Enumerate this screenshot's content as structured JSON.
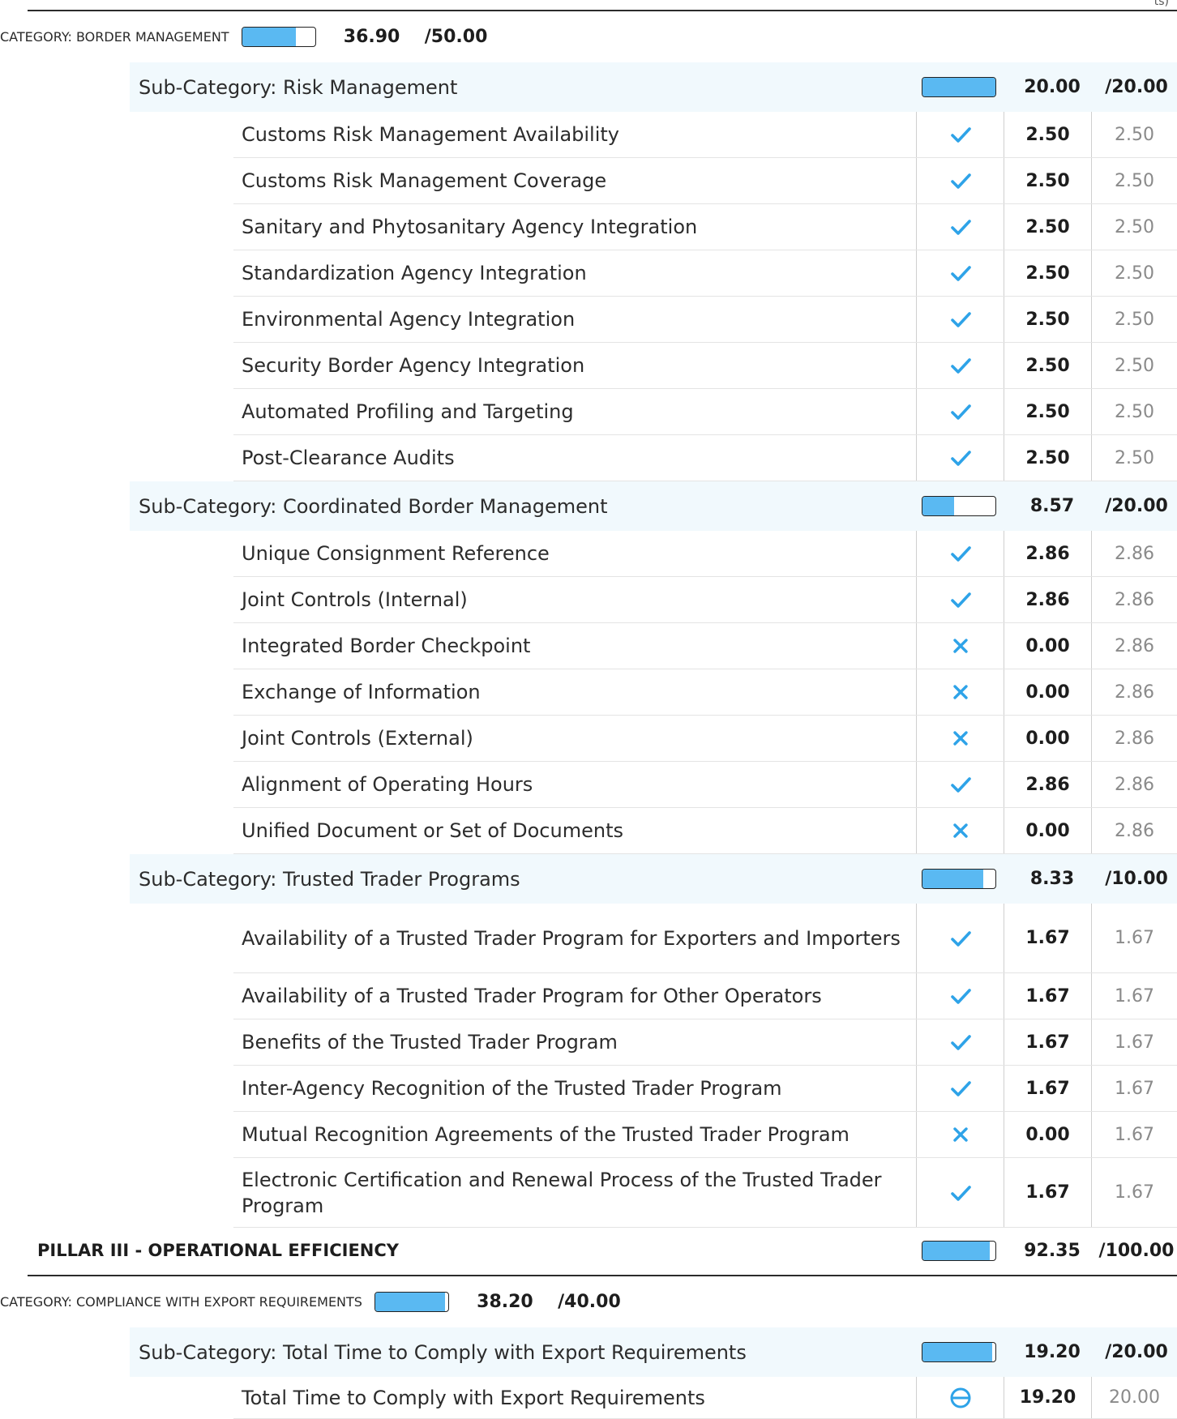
{
  "top_fragment": "ts)",
  "colors": {
    "accent": "#2ea3e8",
    "bar_fill": "#5ab9f2",
    "category_bg": "#edf1f4",
    "subcategory_bg": "#f1f9fd"
  },
  "rows": [
    {
      "type": "category",
      "label": "CATEGORY: BORDER MANAGEMENT",
      "score": "36.90",
      "max": "/50.00",
      "fraction": 0.738
    },
    {
      "type": "sub",
      "label": "Sub-Category: Risk Management",
      "score": "20.00",
      "max": "/20.00",
      "fraction": 1.0
    },
    {
      "type": "item",
      "label": "Customs Risk Management Availability",
      "status": "check-icon",
      "score": "2.50",
      "max": "2.50"
    },
    {
      "type": "item",
      "label": "Customs Risk Management Coverage",
      "status": "check-icon",
      "score": "2.50",
      "max": "2.50"
    },
    {
      "type": "item",
      "label": "Sanitary and Phytosanitary Agency Integration",
      "status": "check-icon",
      "score": "2.50",
      "max": "2.50"
    },
    {
      "type": "item",
      "label": "Standardization Agency Integration",
      "status": "check-icon",
      "score": "2.50",
      "max": "2.50"
    },
    {
      "type": "item",
      "label": "Environmental Agency Integration",
      "status": "check-icon",
      "score": "2.50",
      "max": "2.50"
    },
    {
      "type": "item",
      "label": "Security Border Agency Integration",
      "status": "check-icon",
      "score": "2.50",
      "max": "2.50"
    },
    {
      "type": "item",
      "label": "Automated Profiling and Targeting",
      "status": "check-icon",
      "score": "2.50",
      "max": "2.50"
    },
    {
      "type": "item",
      "label": "Post-Clearance Audits",
      "status": "check-icon",
      "score": "2.50",
      "max": "2.50"
    },
    {
      "type": "sub",
      "label": "Sub-Category: Coordinated Border Management",
      "score": "8.57",
      "max": "/20.00",
      "fraction": 0.4285
    },
    {
      "type": "item",
      "label": "Unique Consignment Reference",
      "status": "check-icon",
      "score": "2.86",
      "max": "2.86"
    },
    {
      "type": "item",
      "label": "Joint Controls (Internal)",
      "status": "check-icon",
      "score": "2.86",
      "max": "2.86"
    },
    {
      "type": "item",
      "label": "Integrated Border Checkpoint",
      "status": "cross-icon",
      "score": "0.00",
      "max": "2.86"
    },
    {
      "type": "item",
      "label": "Exchange of Information",
      "status": "cross-icon",
      "score": "0.00",
      "max": "2.86"
    },
    {
      "type": "item",
      "label": "Joint Controls (External)",
      "status": "cross-icon",
      "score": "0.00",
      "max": "2.86"
    },
    {
      "type": "item",
      "label": "Alignment of Operating Hours",
      "status": "check-icon",
      "score": "2.86",
      "max": "2.86"
    },
    {
      "type": "item",
      "label": "Unified Document or Set of Documents",
      "status": "cross-icon",
      "score": "0.00",
      "max": "2.86"
    },
    {
      "type": "sub",
      "label": "Sub-Category: Trusted Trader Programs",
      "score": "8.33",
      "max": "/10.00",
      "fraction": 0.833
    },
    {
      "type": "item",
      "label": "Availability of a Trusted Trader Program for Exporters and Importers",
      "status": "check-icon",
      "score": "1.67",
      "max": "1.67",
      "tall": true
    },
    {
      "type": "item",
      "label": "Availability of a Trusted Trader Program for Other Operators",
      "status": "check-icon",
      "score": "1.67",
      "max": "1.67"
    },
    {
      "type": "item",
      "label": "Benefits of the Trusted Trader Program",
      "status": "check-icon",
      "score": "1.67",
      "max": "1.67"
    },
    {
      "type": "item",
      "label": "Inter-Agency Recognition of the Trusted Trader Program",
      "status": "check-icon",
      "score": "1.67",
      "max": "1.67"
    },
    {
      "type": "item",
      "label": "Mutual Recognition Agreements of the Trusted Trader Program",
      "status": "cross-icon",
      "score": "0.00",
      "max": "1.67"
    },
    {
      "type": "item",
      "label": "Electronic Certification and Renewal Process of the Trusted Trader Program",
      "status": "check-icon",
      "score": "1.67",
      "max": "1.67",
      "tall": true
    },
    {
      "type": "pillar",
      "label": "PILLAR III - OPERATIONAL EFFICIENCY",
      "score": "92.35",
      "max": "/100.00",
      "fraction": 0.9235
    },
    {
      "type": "category",
      "label": "CATEGORY: COMPLIANCE WITH EXPORT REQUIREMENTS",
      "score": "38.20",
      "max": "/40.00",
      "fraction": 0.955
    },
    {
      "type": "sub",
      "label": "Sub-Category: Total Time to Comply with Export Requirements",
      "score": "19.20",
      "max": "/20.00",
      "fraction": 0.96
    },
    {
      "type": "item",
      "label": "Total Time to Comply with Export Requirements",
      "status": "partial-icon",
      "score": "19.20",
      "max": "20.00"
    }
  ]
}
